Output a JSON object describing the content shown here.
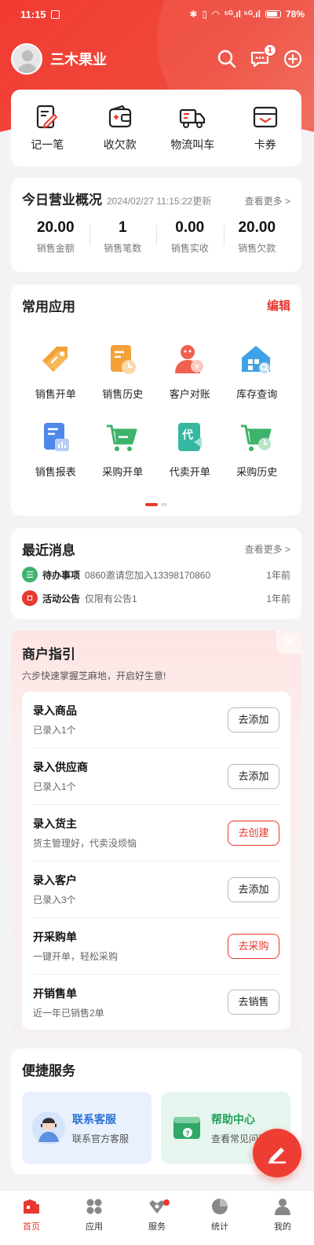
{
  "status": {
    "time": "11:15",
    "battery": "78%",
    "signal": "⁵ᴳ.ıl ⁵ᴳ.ıl"
  },
  "header": {
    "shop_name": "三木果业",
    "message_badge": "1"
  },
  "quick_actions": [
    {
      "label": "记一笔",
      "icon": "note-pen-icon"
    },
    {
      "label": "收欠款",
      "icon": "wallet-icon"
    },
    {
      "label": "物流叫车",
      "icon": "truck-icon"
    },
    {
      "label": "卡券",
      "icon": "coupon-icon"
    }
  ],
  "overview": {
    "title": "今日营业概况",
    "updated": "2024/02/27 11:15:22更新",
    "more": "查看更多 >",
    "stats": [
      {
        "value": "20.00",
        "label": "销售金额"
      },
      {
        "value": "1",
        "label": "销售笔数"
      },
      {
        "value": "0.00",
        "label": "销售实收"
      },
      {
        "value": "20.00",
        "label": "销售欠款"
      }
    ]
  },
  "apps": {
    "title": "常用应用",
    "edit": "编辑",
    "items": [
      {
        "label": "销售开单",
        "icon": "price-tag-icon"
      },
      {
        "label": "销售历史",
        "icon": "sales-history-icon"
      },
      {
        "label": "客户对账",
        "icon": "customer-reconcile-icon"
      },
      {
        "label": "库存查询",
        "icon": "inventory-search-icon"
      },
      {
        "label": "销售报表",
        "icon": "sales-report-icon"
      },
      {
        "label": "采购开单",
        "icon": "purchase-cart-icon"
      },
      {
        "label": "代卖开单",
        "icon": "consignment-doc-icon"
      },
      {
        "label": "采购历史",
        "icon": "purchase-history-icon"
      }
    ],
    "page_indicator": {
      "current": 1,
      "total": 2
    }
  },
  "messages": {
    "title": "最近消息",
    "more": "查看更多 >",
    "items": [
      {
        "category": "待办事项",
        "text": "0860邀请您加入13398170860",
        "time": "1年前",
        "color": "#3db36b"
      },
      {
        "category": "活动公告",
        "text": "仅限有公告1",
        "time": "1年前",
        "color": "#e8392f"
      }
    ]
  },
  "guide": {
    "title": "商户指引",
    "subtitle": "六步快速掌握芝麻地，开启好生意!",
    "close": "✕",
    "steps": [
      {
        "name": "录入商品",
        "desc": "已录入1个",
        "button": "去添加",
        "highlight": false
      },
      {
        "name": "录入供应商",
        "desc": "已录入1个",
        "button": "去添加",
        "highlight": false
      },
      {
        "name": "录入货主",
        "desc": "货主管理好，代卖没烦恼",
        "button": "去创建",
        "highlight": true
      },
      {
        "name": "录入客户",
        "desc": "已录入3个",
        "button": "去添加",
        "highlight": false
      },
      {
        "name": "开采购单",
        "desc": "一键开单，轻松采购",
        "button": "去采购",
        "highlight": true
      },
      {
        "name": "开销售单",
        "desc": "近一年已销售2单",
        "button": "去销售",
        "highlight": false
      }
    ]
  },
  "services": {
    "title": "便捷服务",
    "items": [
      {
        "name": "联系客服",
        "desc": "联系官方客服"
      },
      {
        "name": "帮助中心",
        "desc": "查看常见问题"
      }
    ]
  },
  "tabs": [
    {
      "label": "首页",
      "icon": "home-icon",
      "active": true
    },
    {
      "label": "应用",
      "icon": "apps-grid-icon",
      "active": false
    },
    {
      "label": "服务",
      "icon": "service-icon",
      "active": false
    },
    {
      "label": "统计",
      "icon": "pie-chart-icon",
      "active": false
    },
    {
      "label": "我的",
      "icon": "profile-icon",
      "active": false
    }
  ],
  "colors": {
    "brand": "#e8392f",
    "success": "#3db36b",
    "link_blue": "#2a71d6"
  }
}
